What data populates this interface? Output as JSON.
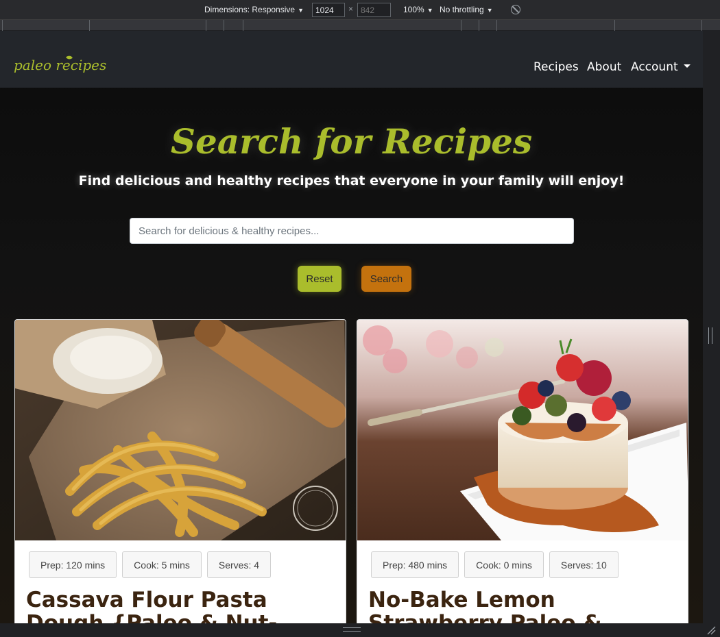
{
  "devtools": {
    "dimensions_label": "Dimensions: Responsive",
    "width_value": "1024",
    "height_placeholder": "842",
    "zoom": "100%",
    "throttling": "No throttling"
  },
  "navbar": {
    "brand": "paleo recipes",
    "links": [
      "Recipes",
      "About",
      "Account"
    ]
  },
  "hero": {
    "title": "Search for Recipes",
    "subtitle": "Find delicious and healthy recipes that everyone in your family will enjoy!"
  },
  "search": {
    "placeholder": "Search for delicious & healthy recipes...",
    "reset_label": "Reset",
    "search_label": "Search"
  },
  "recipes": [
    {
      "title": "Cassava Flour Pasta Dough {Paleo & Nut-Free}",
      "prep": "Prep: 120 mins",
      "cook": "Cook: 5 mins",
      "serves": "Serves: 4",
      "image": "pasta-dough-photo"
    },
    {
      "title": "No-Bake Lemon Strawberry Paleo & Vegan Cheesecake",
      "prep": "Prep: 480 mins",
      "cook": "Cook: 0 mins",
      "serves": "Serves: 10",
      "image": "cheesecake-photo"
    }
  ],
  "colors": {
    "brand_green": "#aabd2c",
    "search_orange": "#c4720e",
    "title_brown": "#3b2410"
  }
}
